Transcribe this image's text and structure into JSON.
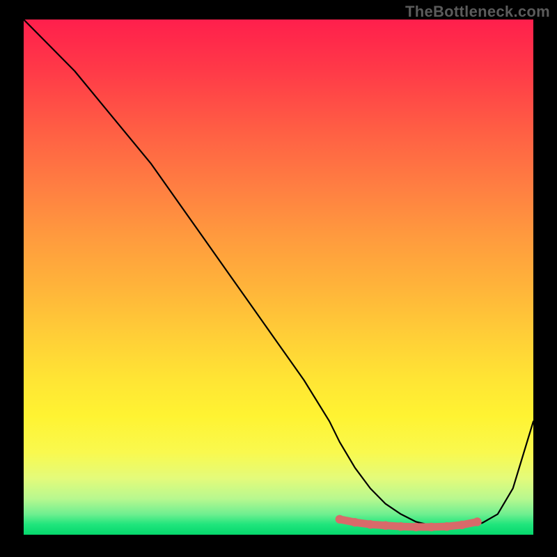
{
  "watermark": "TheBottleneck.com",
  "chart_data": {
    "type": "line",
    "title": "",
    "xlabel": "",
    "ylabel": "",
    "xlim": [
      0,
      100
    ],
    "ylim": [
      0,
      100
    ],
    "series": [
      {
        "name": "bottleneck-curve",
        "x": [
          0,
          5,
          10,
          15,
          20,
          25,
          30,
          35,
          40,
          45,
          50,
          55,
          60,
          62,
          65,
          68,
          71,
          74,
          77,
          80,
          83,
          86,
          90,
          93,
          96,
          100
        ],
        "y": [
          100,
          95,
          90,
          84,
          78,
          72,
          65,
          58,
          51,
          44,
          37,
          30,
          22,
          18,
          13,
          9,
          6,
          4,
          2.5,
          1.8,
          1.5,
          1.6,
          2.3,
          4,
          9,
          22
        ]
      },
      {
        "name": "optimal-range-marker",
        "x": [
          62,
          65,
          68,
          71,
          74,
          77,
          80,
          83,
          86,
          89
        ],
        "y": [
          3.0,
          2.4,
          2.0,
          1.8,
          1.6,
          1.5,
          1.5,
          1.6,
          1.9,
          2.5
        ]
      }
    ],
    "gradient_stops": [
      {
        "pct": 0,
        "color": "#ff1f4c"
      },
      {
        "pct": 50,
        "color": "#ffb43a"
      },
      {
        "pct": 80,
        "color": "#fff332"
      },
      {
        "pct": 100,
        "color": "#05d86d"
      }
    ]
  }
}
